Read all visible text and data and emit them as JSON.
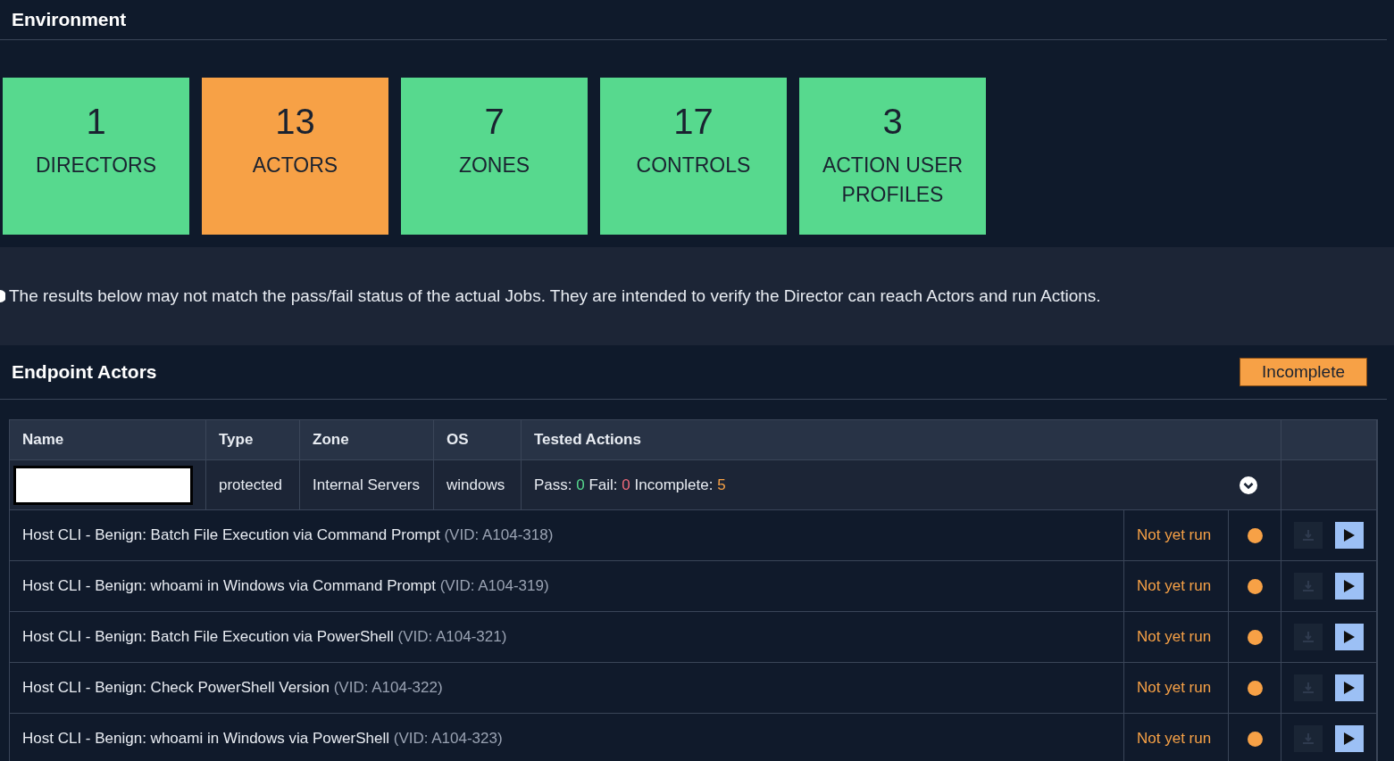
{
  "environment": {
    "title": "Environment"
  },
  "tiles": [
    {
      "count": "1",
      "label": "DIRECTORS",
      "color": "#57d98e"
    },
    {
      "count": "13",
      "label": "ACTORS",
      "color": "#f7a146"
    },
    {
      "count": "7",
      "label": "ZONES",
      "color": "#57d98e"
    },
    {
      "count": "17",
      "label": "CONTROLS",
      "color": "#57d98e"
    },
    {
      "count": "3",
      "label": "ACTION USER PROFILES",
      "color": "#57d98e"
    }
  ],
  "notice": "The results below may not match the pass/fail status of the actual Jobs. They are intended to verify the Director can reach Actors and run Actions.",
  "endpoint_actors": {
    "title": "Endpoint Actors",
    "status": "Incomplete"
  },
  "table": {
    "columns": [
      "Name",
      "Type",
      "Zone",
      "OS",
      "Tested Actions"
    ],
    "actor": {
      "type": "protected",
      "zone": "Internal Servers",
      "os": "windows",
      "pass_label": "Pass:",
      "pass": "0",
      "fail_label": "Fail:",
      "fail": "0",
      "incomplete_label": "Incomplete:",
      "incomplete": "5",
      "expanded": true
    },
    "actions": [
      {
        "name": "Host CLI - Benign: Batch File Execution via Command Prompt",
        "vid": "(VID: A104-318)",
        "status": "Not yet run",
        "color": "#f7a146"
      },
      {
        "name": "Host CLI - Benign: whoami in Windows via Command Prompt",
        "vid": "(VID: A104-319)",
        "status": "Not yet run",
        "color": "#f7a146"
      },
      {
        "name": "Host CLI - Benign: Batch File Execution via PowerShell",
        "vid": "(VID: A104-321)",
        "status": "Not yet run",
        "color": "#f7a146"
      },
      {
        "name": "Host CLI - Benign: Check PowerShell Version",
        "vid": "(VID: A104-322)",
        "status": "Not yet run",
        "color": "#f7a146"
      },
      {
        "name": "Host CLI - Benign: whoami in Windows via PowerShell",
        "vid": "(VID: A104-323)",
        "status": "Not yet run",
        "color": "#f7a146"
      }
    ]
  }
}
